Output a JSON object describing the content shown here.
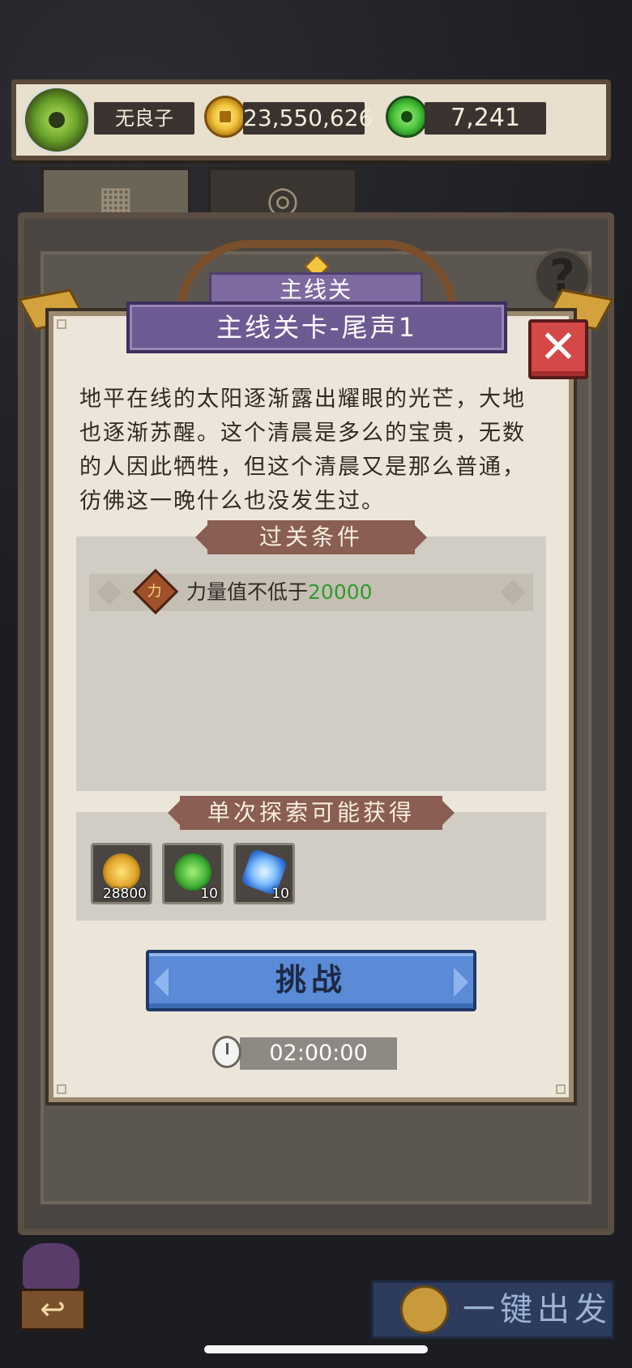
{
  "resources": {
    "player_name": "无良子",
    "gold": "23,550,626",
    "jade": "7,241"
  },
  "dialog": {
    "header_small": "主线关",
    "title": "主线关卡-尾声1",
    "close_symbol": "✕",
    "description": "地平在线的太阳逐渐露出耀眼的光芒，大地也逐渐苏醒。这个清晨是多么的宝贵，无数的人因此牺牲，但这个清晨又是那么普通，彷佛这一晚什么也没发生过。",
    "conditions_title": "过关条件",
    "condition": {
      "badge": "力",
      "text": "力量值不低于",
      "value": "20000"
    },
    "rewards_title": "单次探索可能获得",
    "rewards": [
      {
        "icon": "gold-coins-icon",
        "count": "28800"
      },
      {
        "icon": "jade-token-icon",
        "count": "10"
      },
      {
        "icon": "crystal-icon",
        "count": "10"
      }
    ],
    "challenge_label": "挑战",
    "timer": "02:00:00"
  },
  "help_symbol": "?",
  "bottom": {
    "back_symbol": "↩",
    "go_label": "一键出发"
  },
  "colors": {
    "purple_ribbon": "#6e5a92",
    "challenge_blue": "#5b8ad6",
    "close_red": "#d44848",
    "condition_green": "#2f9a2f"
  }
}
